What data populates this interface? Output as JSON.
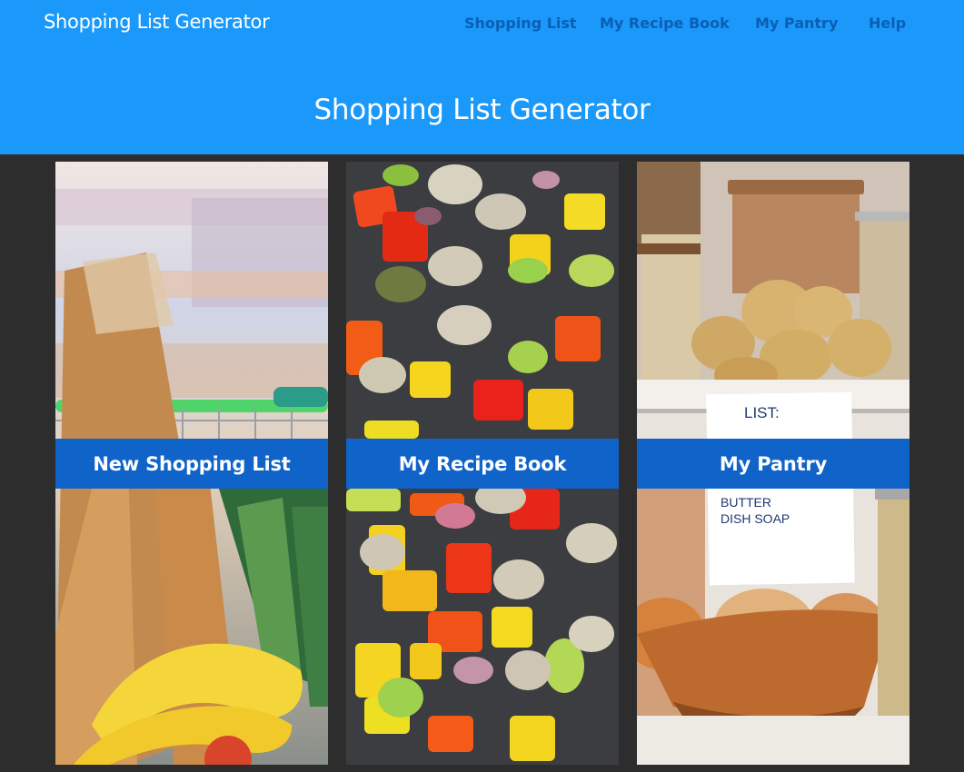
{
  "header": {
    "brand": "Shopping List Generator",
    "nav": [
      "Shopping List",
      "My Recipe Book",
      "My Pantry",
      "Help"
    ],
    "title": "Shopping List Generator",
    "bg_color": "#1b99fb",
    "nav_color": "#0a5fb3"
  },
  "cards": [
    {
      "label": "New Shopping List",
      "image": "grocery-cart-photo"
    },
    {
      "label": "My Recipe Book",
      "image": "roasted-vegetables-photo"
    },
    {
      "label": "My Pantry",
      "image": "pantry-shelf-photo"
    }
  ],
  "pantry_note": {
    "heading": "LIST:",
    "items": [
      "BUTTER",
      "DISH SOAP"
    ]
  },
  "colors": {
    "page_bg": "#2d2d2d",
    "label_bg": "#0f63c9"
  }
}
